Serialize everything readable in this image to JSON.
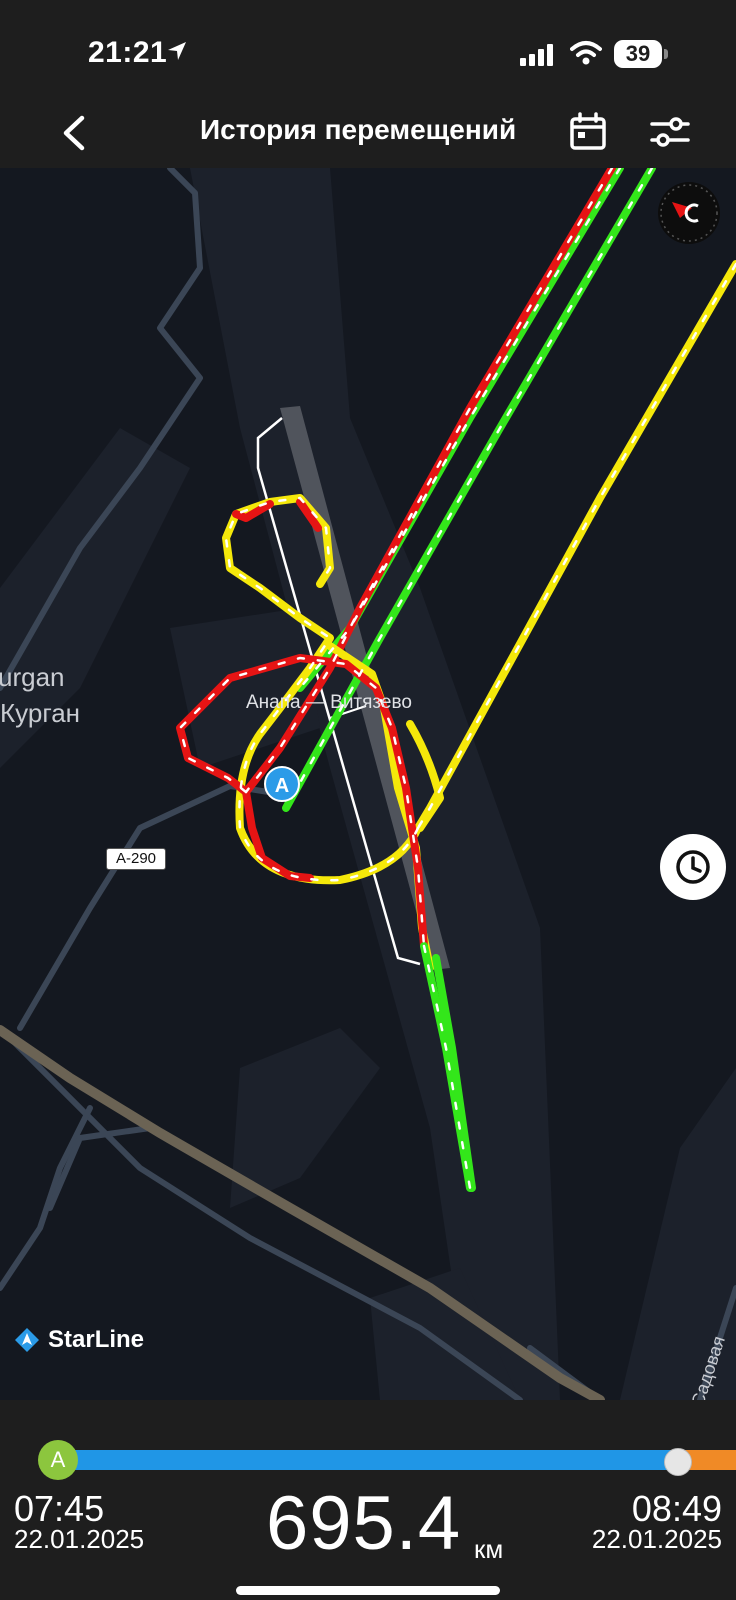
{
  "status_bar": {
    "time": "21:21",
    "battery": "39",
    "icons": [
      "location-arrow-icon",
      "signal-icon",
      "wifi-icon",
      "battery-icon"
    ]
  },
  "header": {
    "title": "История перемещений",
    "icons": [
      "chevron-left-icon",
      "calendar-icon",
      "sliders-icon"
    ]
  },
  "map": {
    "labels": {
      "place_latin": "urgan",
      "place_cyrillic": "Курган",
      "airport": "Анапа — Витязево",
      "road_badge": "A-290",
      "street": "Садовая"
    },
    "brand": "StarLine",
    "start_marker": "A",
    "track_colors": {
      "green": "#33e61a",
      "yellow": "#f5e80a",
      "red": "#e61414"
    }
  },
  "bottom_panel": {
    "start_marker": "A",
    "start_time": "07:45",
    "start_date": "22.01.2025",
    "end_time": "08:49",
    "end_date": "22.01.2025",
    "distance": "695.4",
    "distance_unit": "км",
    "colors": {
      "track_main": "#2096e6",
      "track_end": "#f08a26",
      "start_knob": "#8cc63e"
    }
  }
}
